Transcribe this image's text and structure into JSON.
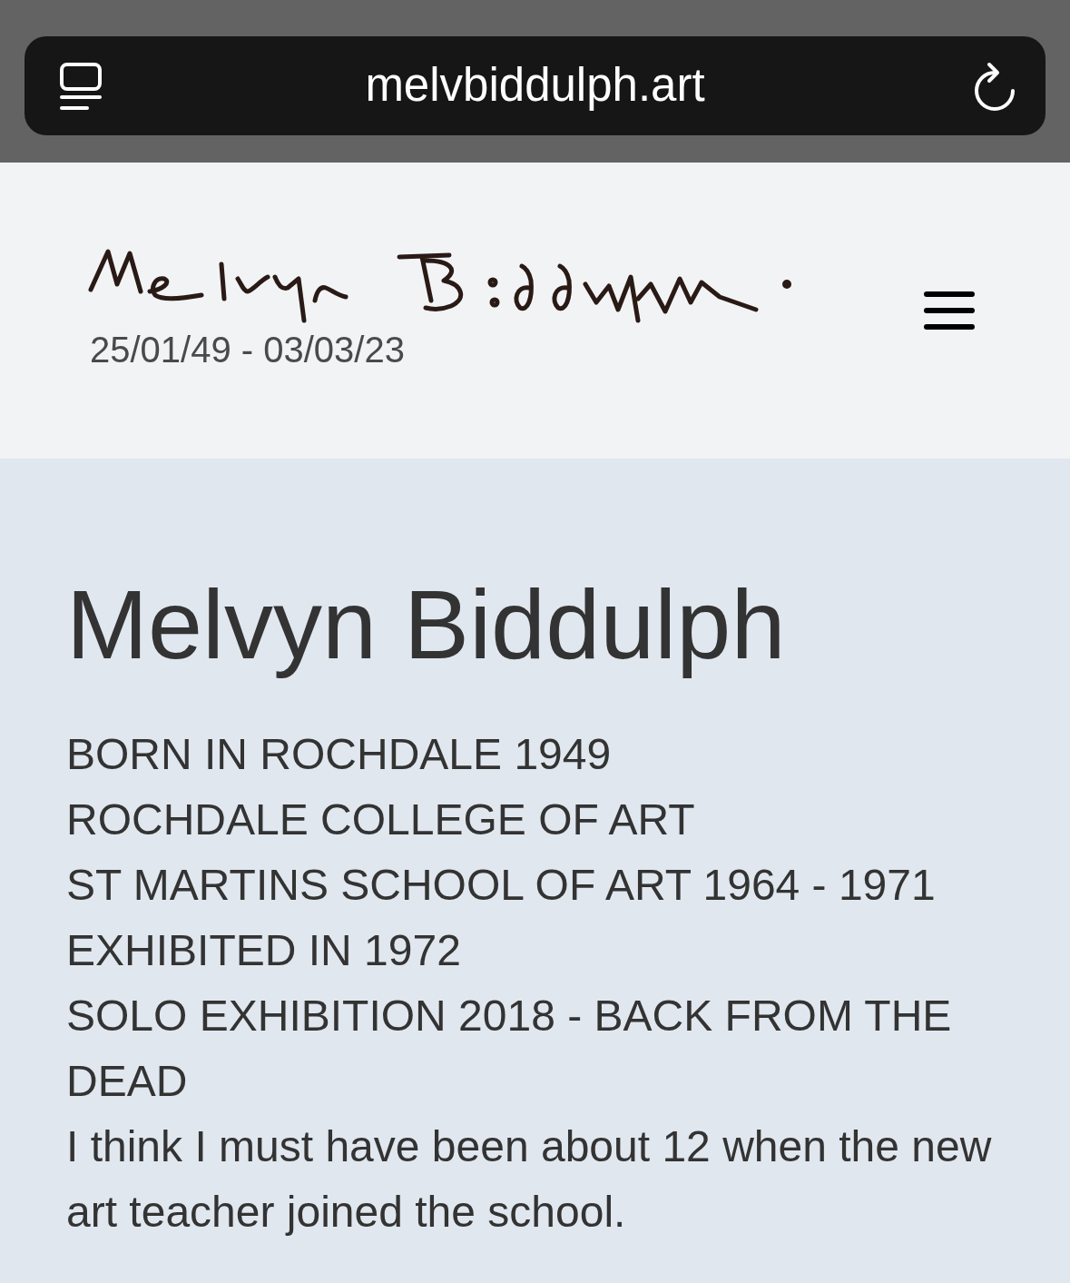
{
  "browser": {
    "url": "melvbiddulph.art"
  },
  "header": {
    "dates": "25/01/49 - 03/03/23"
  },
  "main": {
    "heading": "Melvyn Biddulph",
    "facts": [
      "BORN IN ROCHDALE 1949",
      "ROCHDALE COLLEGE OF ART",
      "ST MARTINS SCHOOL OF ART 1964 - 1971",
      "EXHIBITED IN 1972",
      "SOLO EXHIBITION 2018 - BACK FROM THE DEAD"
    ],
    "paragraph": "I think I must have been about 12 when the new art teacher joined the school."
  }
}
